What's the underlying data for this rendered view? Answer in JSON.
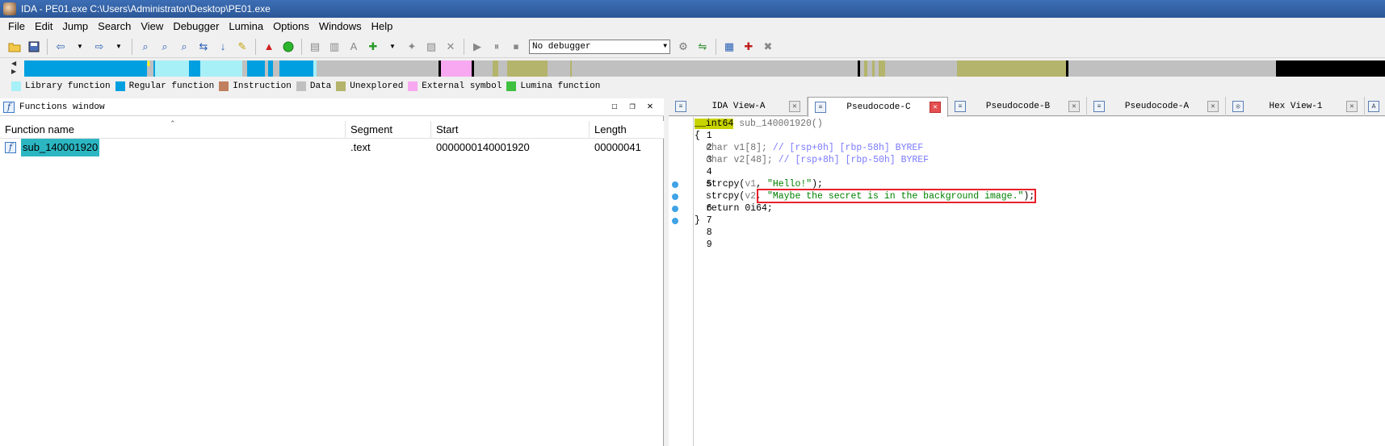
{
  "window": {
    "title": "IDA - PE01.exe C:\\Users\\Administrator\\Desktop\\PE01.exe"
  },
  "menu": [
    "File",
    "Edit",
    "Jump",
    "Search",
    "View",
    "Debugger",
    "Lumina",
    "Options",
    "Windows",
    "Help"
  ],
  "toolbar": {
    "debugger_selected": "No debugger"
  },
  "legend": [
    {
      "label": "Library function",
      "color": "#a8f0f8"
    },
    {
      "label": "Regular function",
      "color": "#00a0e0"
    },
    {
      "label": "Instruction",
      "color": "#c08060"
    },
    {
      "label": "Data",
      "color": "#c0c0c0"
    },
    {
      "label": "Unexplored",
      "color": "#b4b46c"
    },
    {
      "label": "External symbol",
      "color": "#f8a8f0"
    },
    {
      "label": "Lumina function",
      "color": "#40c040"
    }
  ],
  "functions_window": {
    "title": "Functions window",
    "columns": [
      "Function name",
      "Segment",
      "Start",
      "Length"
    ],
    "rows": [
      {
        "name": "sub_140001920",
        "segment": ".text",
        "start": "0000000140001920",
        "length": "00000041"
      }
    ]
  },
  "tabs": [
    {
      "label": "IDA View-A",
      "active": false
    },
    {
      "label": "Pseudocode-C",
      "active": true
    },
    {
      "label": "Pseudocode-B",
      "active": false
    },
    {
      "label": "Pseudocode-A",
      "active": false
    },
    {
      "label": "Hex View-1",
      "active": false
    }
  ],
  "pseudocode": {
    "ln1": "1",
    "ln2": "2",
    "ln3": "3",
    "ln4": "4",
    "ln5": "5",
    "ln6": "6",
    "ln7": "7",
    "ln8": "8",
    "ln9": "9",
    "sig_type": "__int64",
    "sig_name": "sub_140001920()",
    "open_brace": "{",
    "close_brace": "}",
    "decl1_type": "char",
    "decl1_var": "v1",
    "decl1_size": "[8];",
    "decl1_comment": "// [rsp+0h] [rbp-58h] BYREF",
    "decl2_type": "char",
    "decl2_var": "v2",
    "decl2_size": "[48];",
    "decl2_comment": "// [rsp+8h] [rbp-50h] BYREF",
    "call1_fn": "strcpy(",
    "call1_arg": "v1",
    "call1_str": "\"Hello!\"",
    "call1_end": ");",
    "call2_fn": "strcpy(",
    "call2_arg": "v2",
    "call2_str": "\"Maybe the secret is in the background image.\"",
    "call2_end": ");",
    "ret_kw": "return",
    "ret_val": "0i64;"
  }
}
